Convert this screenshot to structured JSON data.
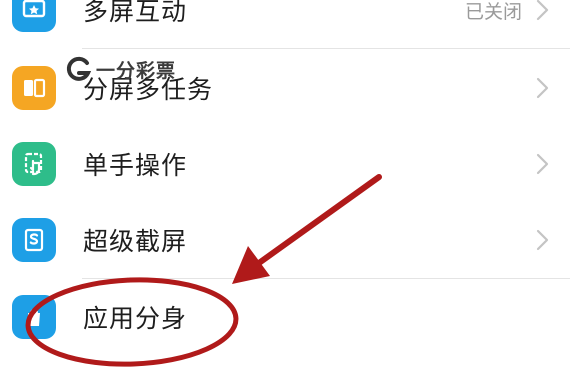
{
  "settings": {
    "items": [
      {
        "label": "多屏互动",
        "status": "已关闭",
        "icon": "multi-screen-icon",
        "icon_color": "#1e9fe6"
      },
      {
        "label": "分屏多任务",
        "icon": "split-screen-icon",
        "icon_color": "#f5a623"
      },
      {
        "label": "单手操作",
        "icon": "one-hand-icon",
        "icon_color": "#2ebd8a"
      },
      {
        "label": "超级截屏",
        "icon": "super-screenshot-icon",
        "icon_color": "#1e9fe6"
      },
      {
        "label": "应用分身",
        "icon": "app-clone-icon",
        "icon_color": "#1e9fe6"
      }
    ]
  },
  "watermark": {
    "text": "一分彩票"
  },
  "annotation": {
    "color": "#b01a1a"
  }
}
